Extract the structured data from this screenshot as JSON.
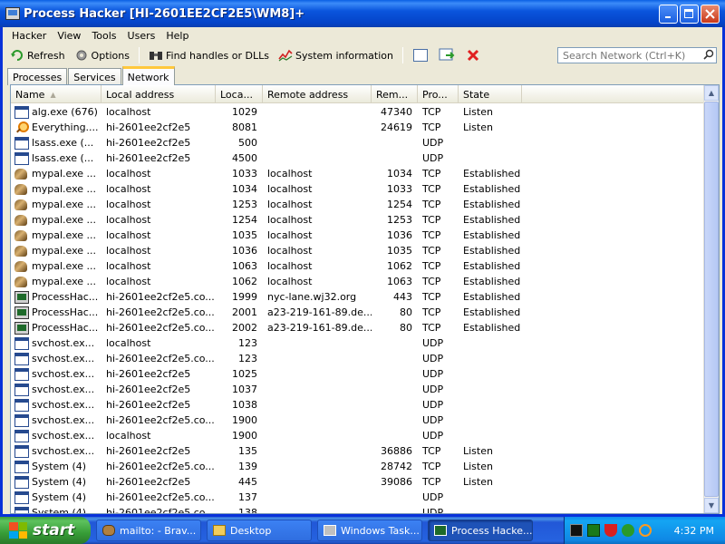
{
  "window": {
    "title": "Process Hacker [HI-2601EE2CF2E5\\WM8]+"
  },
  "menu": [
    "Hacker",
    "View",
    "Tools",
    "Users",
    "Help"
  ],
  "toolbar": {
    "refresh": "Refresh",
    "options": "Options",
    "find_handles": "Find handles or DLLs",
    "system_information": "System information"
  },
  "search": {
    "placeholder": "Search Network (Ctrl+K)"
  },
  "tabs": [
    "Processes",
    "Services",
    "Network"
  ],
  "active_tab": "Network",
  "columns": [
    "Name",
    "Local address",
    "Loca...",
    "Remote address",
    "Rem...",
    "Pro...",
    "State"
  ],
  "rows": [
    {
      "icon": "window-icon",
      "name": "alg.exe (676)",
      "local": "localhost",
      "lport": "1029",
      "remote": "",
      "rport": "47340",
      "proto": "TCP",
      "state": "Listen"
    },
    {
      "icon": "search-icon",
      "name": "Everything....",
      "local": "hi-2601ee2cf2e5",
      "lport": "8081",
      "remote": "",
      "rport": "24619",
      "proto": "TCP",
      "state": "Listen"
    },
    {
      "icon": "window-icon",
      "name": "lsass.exe (...",
      "local": "hi-2601ee2cf2e5",
      "lport": "500",
      "remote": "",
      "rport": "",
      "proto": "UDP",
      "state": ""
    },
    {
      "icon": "window-icon",
      "name": "lsass.exe (...",
      "local": "hi-2601ee2cf2e5",
      "lport": "4500",
      "remote": "",
      "rport": "",
      "proto": "UDP",
      "state": ""
    },
    {
      "icon": "palemoon-icon",
      "name": "mypal.exe ...",
      "local": "localhost",
      "lport": "1033",
      "remote": "localhost",
      "rport": "1034",
      "proto": "TCP",
      "state": "Established"
    },
    {
      "icon": "palemoon-icon",
      "name": "mypal.exe ...",
      "local": "localhost",
      "lport": "1034",
      "remote": "localhost",
      "rport": "1033",
      "proto": "TCP",
      "state": "Established"
    },
    {
      "icon": "palemoon-icon",
      "name": "mypal.exe ...",
      "local": "localhost",
      "lport": "1253",
      "remote": "localhost",
      "rport": "1254",
      "proto": "TCP",
      "state": "Established"
    },
    {
      "icon": "palemoon-icon",
      "name": "mypal.exe ...",
      "local": "localhost",
      "lport": "1254",
      "remote": "localhost",
      "rport": "1253",
      "proto": "TCP",
      "state": "Established"
    },
    {
      "icon": "palemoon-icon",
      "name": "mypal.exe ...",
      "local": "localhost",
      "lport": "1035",
      "remote": "localhost",
      "rport": "1036",
      "proto": "TCP",
      "state": "Established"
    },
    {
      "icon": "palemoon-icon",
      "name": "mypal.exe ...",
      "local": "localhost",
      "lport": "1036",
      "remote": "localhost",
      "rport": "1035",
      "proto": "TCP",
      "state": "Established"
    },
    {
      "icon": "palemoon-icon",
      "name": "mypal.exe ...",
      "local": "localhost",
      "lport": "1063",
      "remote": "localhost",
      "rport": "1062",
      "proto": "TCP",
      "state": "Established"
    },
    {
      "icon": "palemoon-icon",
      "name": "mypal.exe ...",
      "local": "localhost",
      "lport": "1062",
      "remote": "localhost",
      "rport": "1063",
      "proto": "TCP",
      "state": "Established"
    },
    {
      "icon": "processhacker-icon",
      "name": "ProcessHac...",
      "local": "hi-2601ee2cf2e5.co...",
      "lport": "1999",
      "remote": "nyc-lane.wj32.org",
      "rport": "443",
      "proto": "TCP",
      "state": "Established"
    },
    {
      "icon": "processhacker-icon",
      "name": "ProcessHac...",
      "local": "hi-2601ee2cf2e5.co...",
      "lport": "2001",
      "remote": "a23-219-161-89.de...",
      "rport": "80",
      "proto": "TCP",
      "state": "Established"
    },
    {
      "icon": "processhacker-icon",
      "name": "ProcessHac...",
      "local": "hi-2601ee2cf2e5.co...",
      "lport": "2002",
      "remote": "a23-219-161-89.de...",
      "rport": "80",
      "proto": "TCP",
      "state": "Established"
    },
    {
      "icon": "window-icon",
      "name": "svchost.ex...",
      "local": "localhost",
      "lport": "123",
      "remote": "",
      "rport": "",
      "proto": "UDP",
      "state": ""
    },
    {
      "icon": "window-icon",
      "name": "svchost.ex...",
      "local": "hi-2601ee2cf2e5.co...",
      "lport": "123",
      "remote": "",
      "rport": "",
      "proto": "UDP",
      "state": ""
    },
    {
      "icon": "window-icon",
      "name": "svchost.ex...",
      "local": "hi-2601ee2cf2e5",
      "lport": "1025",
      "remote": "",
      "rport": "",
      "proto": "UDP",
      "state": ""
    },
    {
      "icon": "window-icon",
      "name": "svchost.ex...",
      "local": "hi-2601ee2cf2e5",
      "lport": "1037",
      "remote": "",
      "rport": "",
      "proto": "UDP",
      "state": ""
    },
    {
      "icon": "window-icon",
      "name": "svchost.ex...",
      "local": "hi-2601ee2cf2e5",
      "lport": "1038",
      "remote": "",
      "rport": "",
      "proto": "UDP",
      "state": ""
    },
    {
      "icon": "window-icon",
      "name": "svchost.ex...",
      "local": "hi-2601ee2cf2e5.co...",
      "lport": "1900",
      "remote": "",
      "rport": "",
      "proto": "UDP",
      "state": ""
    },
    {
      "icon": "window-icon",
      "name": "svchost.ex...",
      "local": "localhost",
      "lport": "1900",
      "remote": "",
      "rport": "",
      "proto": "UDP",
      "state": ""
    },
    {
      "icon": "window-icon",
      "name": "svchost.ex...",
      "local": "hi-2601ee2cf2e5",
      "lport": "135",
      "remote": "",
      "rport": "36886",
      "proto": "TCP",
      "state": "Listen"
    },
    {
      "icon": "window-icon",
      "name": "System (4)",
      "local": "hi-2601ee2cf2e5.co...",
      "lport": "139",
      "remote": "",
      "rport": "28742",
      "proto": "TCP",
      "state": "Listen"
    },
    {
      "icon": "window-icon",
      "name": "System (4)",
      "local": "hi-2601ee2cf2e5",
      "lport": "445",
      "remote": "",
      "rport": "39086",
      "proto": "TCP",
      "state": "Listen"
    },
    {
      "icon": "window-icon",
      "name": "System (4)",
      "local": "hi-2601ee2cf2e5.co...",
      "lport": "137",
      "remote": "",
      "rport": "",
      "proto": "UDP",
      "state": ""
    },
    {
      "icon": "window-icon",
      "name": "System (4)",
      "local": "hi-2601ee2cf2e5.co...",
      "lport": "138",
      "remote": "",
      "rport": "",
      "proto": "UDP",
      "state": ""
    }
  ],
  "taskbar": {
    "start": "start",
    "tasks": [
      {
        "label": "mailto: - Brav...",
        "icon": "palemoon-icon",
        "active": false
      },
      {
        "label": "Desktop",
        "icon": "folder-icon",
        "active": false
      },
      {
        "label": "Windows Task...",
        "icon": "taskmanager-icon",
        "active": false
      },
      {
        "label": "Process Hacke...",
        "icon": "processhacker-icon",
        "active": true
      }
    ],
    "tray_icons": [
      "terminal-icon",
      "network-monitor-icon",
      "shield-icon",
      "security-icon",
      "everything-search-icon"
    ],
    "clock": "4:32 PM"
  },
  "colors": {
    "titlebar": "#0a55dd",
    "tab_highlight": "#ffc83c",
    "close_icon": "#e02020"
  }
}
